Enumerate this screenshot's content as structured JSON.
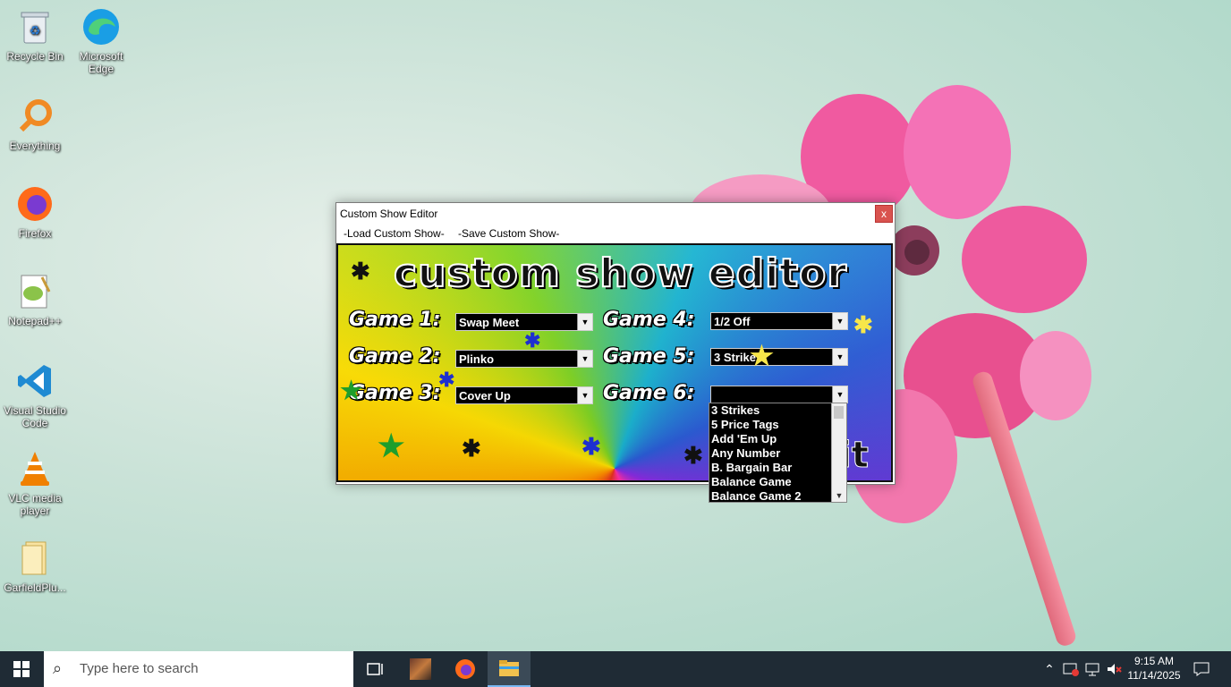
{
  "desktop_icons": [
    {
      "label": "Recycle Bin",
      "icon": "recycle-bin-icon"
    },
    {
      "label": "Microsoft Edge",
      "icon": "edge-icon"
    },
    {
      "label": "Everything",
      "icon": "everything-search-icon"
    },
    {
      "label": "Firefox",
      "icon": "firefox-icon"
    },
    {
      "label": "Notepad++",
      "icon": "notepad-plus-plus-icon"
    },
    {
      "label": "Visual Studio Code",
      "icon": "vscode-icon"
    },
    {
      "label": "VLC media player",
      "icon": "vlc-icon"
    },
    {
      "label": "GarfieldPlu...",
      "icon": "folder-icon"
    }
  ],
  "window": {
    "title": "Custom Show Editor",
    "close_label": "x",
    "menu": [
      "-Load Custom Show-",
      "-Save Custom Show-"
    ],
    "banner": "custom show editor",
    "exit_label": "it",
    "games": [
      {
        "label": "Game 1:",
        "value": "Swap Meet"
      },
      {
        "label": "Game 2:",
        "value": "Plinko"
      },
      {
        "label": "Game 3:",
        "value": "Cover Up"
      },
      {
        "label": "Game 4:",
        "value": "1/2 Off"
      },
      {
        "label": "Game 5:",
        "value": "3 Strikes"
      },
      {
        "label": "Game 6:",
        "value": ""
      }
    ]
  },
  "dropdown_options": [
    "3 Strikes",
    "5 Price Tags",
    "Add 'Em Up",
    "Any Number",
    "B. Bargain Bar",
    "Balance Game",
    "Balance Game 2"
  ],
  "taskbar": {
    "search_placeholder": "Type here to search",
    "time": "9:15 AM",
    "date": "11/14/2025"
  }
}
